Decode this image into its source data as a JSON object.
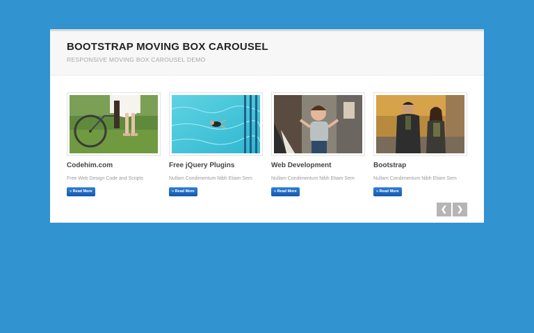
{
  "header": {
    "title": "BOOTSTRAP MOVING BOX CAROUSEL",
    "subtitle": "RESPONSIVE MOVING BOX CAROUSEL DEMO"
  },
  "cards": [
    {
      "title": "Codehim.com",
      "desc": "Free Web Design Code and Scripts",
      "button": "» Read More",
      "image": "photo-bicycle-couple"
    },
    {
      "title": "Free jQuery Plugins",
      "desc": "Nullam Condimentum Nibh Etiam Sem",
      "button": "» Read More",
      "image": "photo-swimmer-pool"
    },
    {
      "title": "Web Development",
      "desc": "Nullam Condimentum Nibh Etiam Sem",
      "button": "» Read More",
      "image": "photo-baby-family"
    },
    {
      "title": "Bootstrap",
      "desc": "Nullam Condimentum Nibh Etiam Sem",
      "button": "» Read More",
      "image": "photo-couple-autumn"
    }
  ],
  "nav": {
    "prev": "❮",
    "next": "❯"
  },
  "colors": {
    "background": "#3193cf",
    "button": "#1d66c2",
    "nav": "#b5b5b5"
  }
}
